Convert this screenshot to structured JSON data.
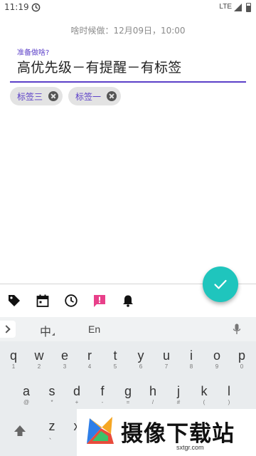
{
  "status_bar": {
    "time": "11:19",
    "network": "LTE"
  },
  "reminder": {
    "when_text": "啥时候做：12月09日，10:00"
  },
  "task_field": {
    "label": "准备做啥?",
    "value": "高优先级－有提醒－有标签"
  },
  "tags": [
    {
      "label": "标签三"
    },
    {
      "label": "标签一"
    }
  ],
  "toolbar": {
    "icons": [
      "tag-icon",
      "calendar-icon",
      "clock-icon",
      "priority-icon",
      "bell-icon"
    ],
    "priority_color": "#e8408a"
  },
  "fab": {
    "icon": "check-icon",
    "color": "#1fc5bd"
  },
  "keyboard": {
    "lang_cn": "中",
    "lang_en": "En",
    "row1": [
      {
        "l": "q",
        "h": "1"
      },
      {
        "l": "w",
        "h": "2"
      },
      {
        "l": "e",
        "h": "3"
      },
      {
        "l": "r",
        "h": "4"
      },
      {
        "l": "t",
        "h": "5"
      },
      {
        "l": "y",
        "h": "6"
      },
      {
        "l": "u",
        "h": "7"
      },
      {
        "l": "i",
        "h": "8"
      },
      {
        "l": "o",
        "h": "9"
      },
      {
        "l": "p",
        "h": "0"
      }
    ],
    "row2": [
      {
        "l": "a",
        "h": "@"
      },
      {
        "l": "s",
        "h": "*"
      },
      {
        "l": "d",
        "h": "+"
      },
      {
        "l": "f",
        "h": "-"
      },
      {
        "l": "g",
        "h": "="
      },
      {
        "l": "h",
        "h": "/"
      },
      {
        "l": "j",
        "h": "#"
      },
      {
        "l": "k",
        "h": "("
      },
      {
        "l": "l",
        "h": ")"
      }
    ],
    "row3": [
      {
        "l": "z",
        "h": "、"
      },
      {
        "l": "x",
        "h": ""
      }
    ]
  },
  "watermark": {
    "title": "摄像下载站",
    "url": "sxtgr.com"
  }
}
